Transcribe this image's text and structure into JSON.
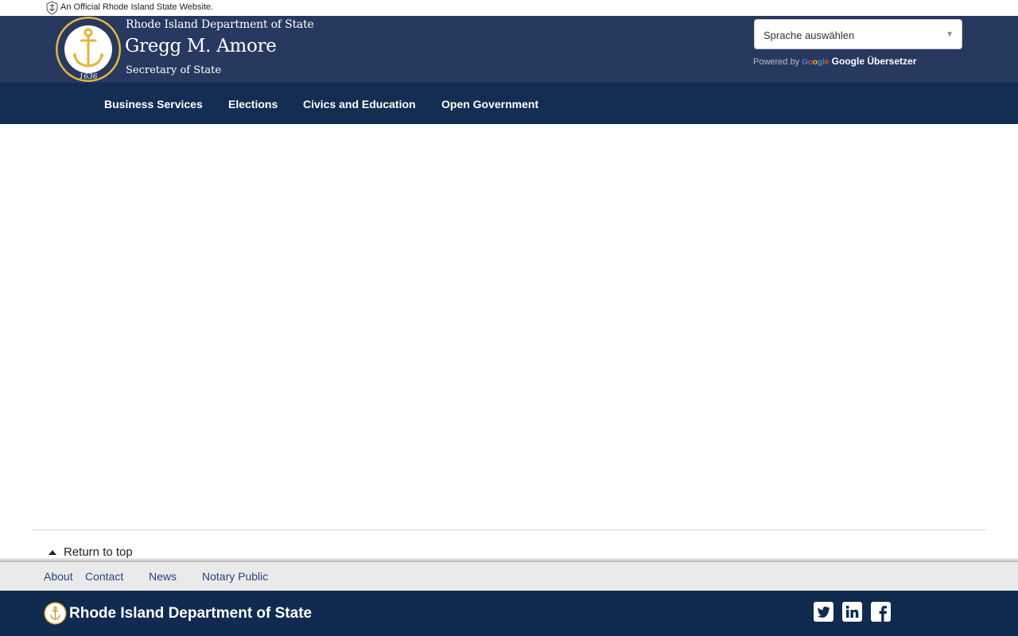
{
  "official_banner": {
    "text": "An Official Rhode Island State Website."
  },
  "header": {
    "department": "Rhode Island Department of State",
    "name": "Gregg M. Amore",
    "title": "Secretary of State",
    "seal_year": "1636"
  },
  "translate": {
    "select_value": "Sprache auswählen",
    "powered_by": "Powered by",
    "google_logo": [
      "G",
      "o",
      "o",
      "g",
      "l",
      "e"
    ],
    "translate_label": "Google Übersetzer"
  },
  "nav": {
    "items": [
      {
        "label": "Business Services"
      },
      {
        "label": "Elections"
      },
      {
        "label": "Civics and Education"
      },
      {
        "label": "Open Government"
      }
    ]
  },
  "return_top": {
    "label": "Return to top"
  },
  "footer_links": {
    "items": [
      {
        "label": "About"
      },
      {
        "label": "Contact"
      },
      {
        "label": "News"
      },
      {
        "label": "Notary Public"
      }
    ]
  },
  "footer": {
    "org_name": "Rhode Island Department of State",
    "social": [
      "twitter-icon",
      "linkedin-icon",
      "facebook-icon"
    ]
  },
  "colors": {
    "header_bg": "#27395e",
    "nav_bg": "#142d52",
    "footer_bg": "#102a50",
    "seal_gold": "#e6b43c",
    "footer_link": "#25477e"
  }
}
